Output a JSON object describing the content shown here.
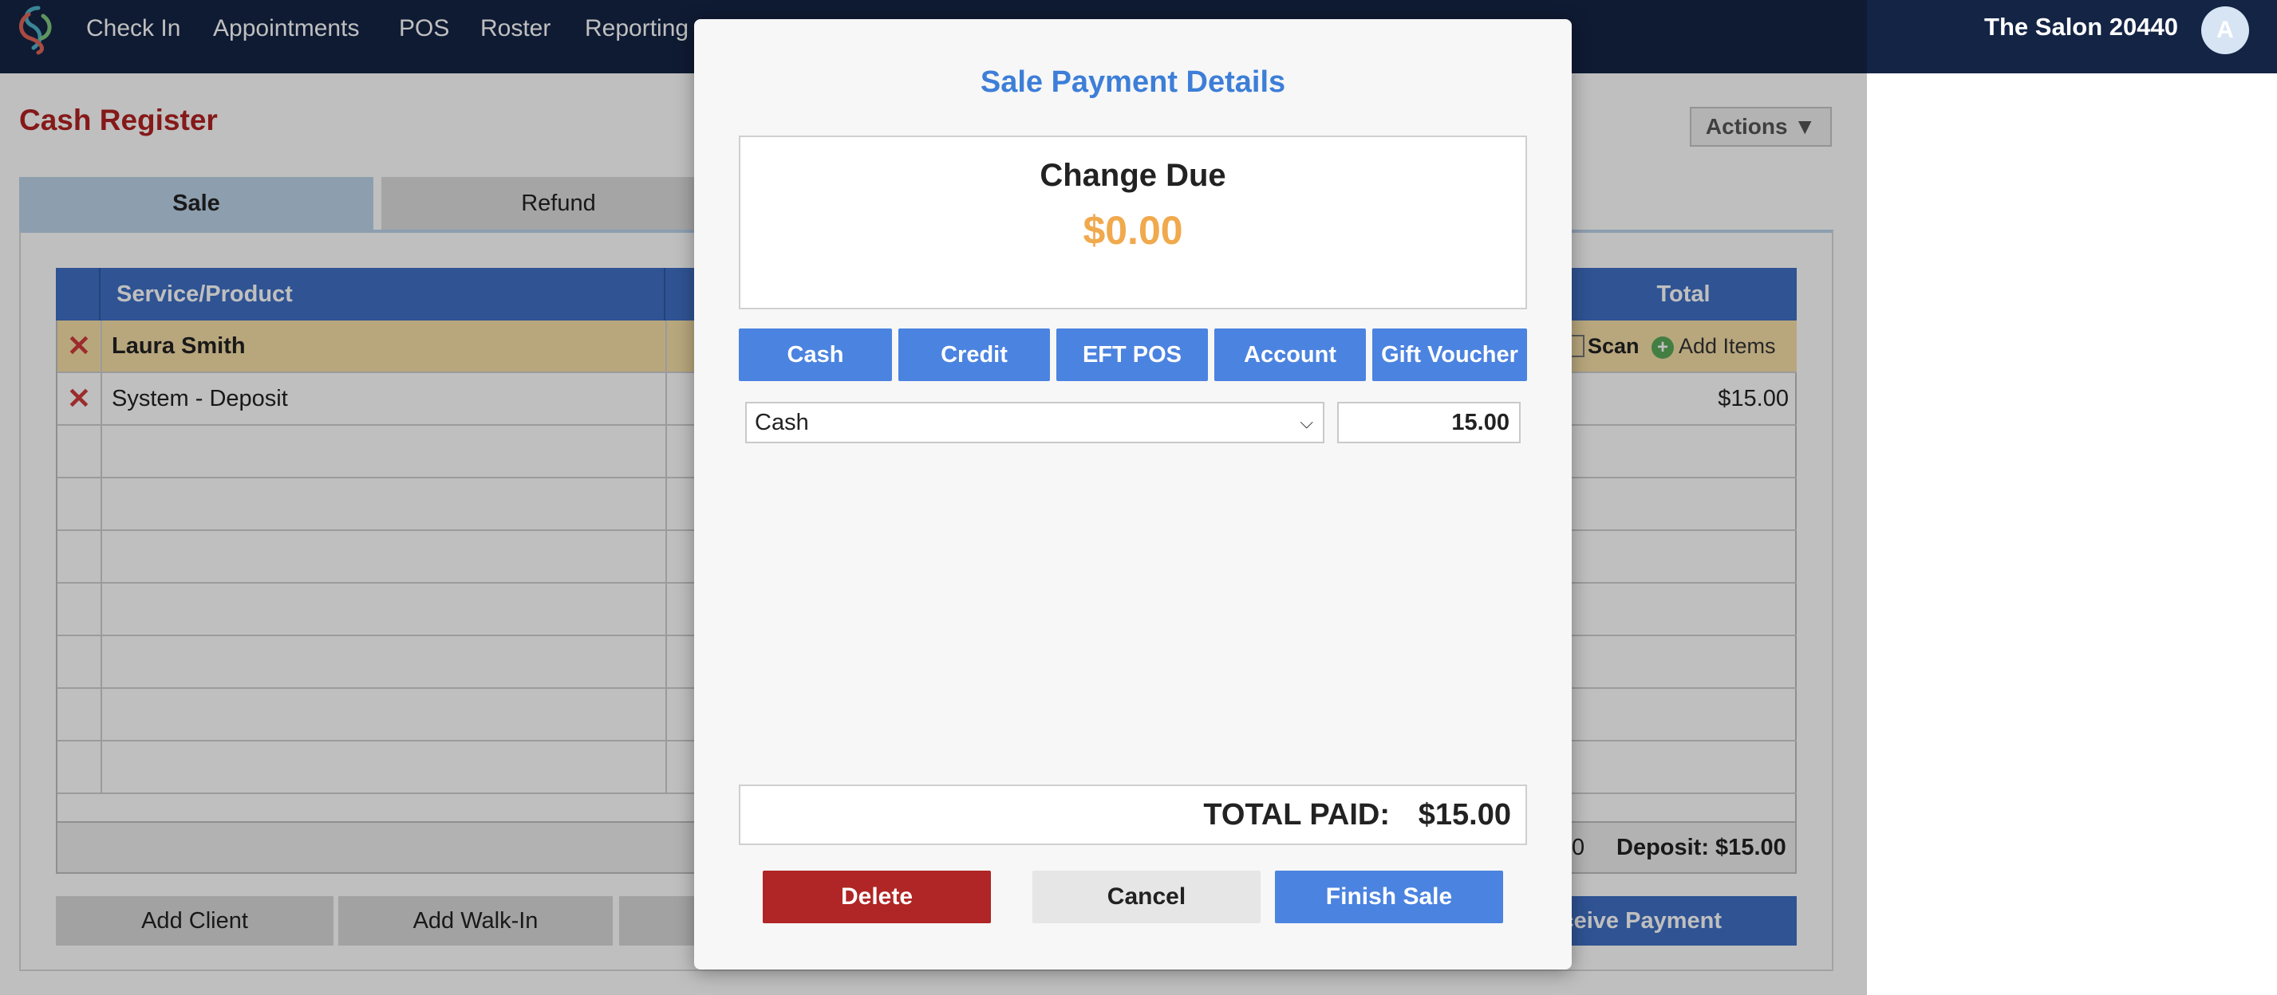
{
  "nav": {
    "items": [
      "Check In",
      "Appointments",
      "POS",
      "Roster",
      "Reporting"
    ],
    "salon_name": "The Salon 20440",
    "avatar_initial": "A"
  },
  "page": {
    "title": "Cash Register",
    "actions_label": "Actions ▼",
    "tabs": [
      "Sale",
      "Refund"
    ]
  },
  "grid": {
    "headers": {
      "service_product": "Service/Product",
      "total": "Total"
    },
    "client_row": {
      "name": "Laura Smith",
      "scan": "Scan",
      "add_items": "Add Items"
    },
    "rows": [
      {
        "name": "System - Deposit",
        "total": "$15.00"
      }
    ],
    "footer": {
      "partial_value": "0",
      "deposit": "Deposit: $15.00"
    }
  },
  "actions": {
    "add_client": "Add Client",
    "add_walkin": "Add Walk-In",
    "receive_payment": "ceive Payment"
  },
  "modal": {
    "title": "Sale Payment Details",
    "change_due_label": "Change Due",
    "change_due_amount": "$0.00",
    "payment_methods": [
      "Cash",
      "Credit",
      "EFT POS",
      "Account",
      "Gift Voucher"
    ],
    "selected_method": "Cash",
    "amount": "15.00",
    "total_paid_label": "TOTAL PAID:",
    "total_paid_value": "$15.00",
    "buttons": {
      "delete": "Delete",
      "cancel": "Cancel",
      "finish": "Finish Sale"
    }
  },
  "colors": {
    "nav_bg": "#142445",
    "accent_blue": "#4b83e0",
    "title_red": "#b22222",
    "change_orange": "#f0a94d",
    "delete_red": "#b02525",
    "client_row_bg": "#f6dfa7"
  },
  "icons": {
    "logo": "salon-logo-icon",
    "remove": "close-x-icon",
    "scan": "barcode-scan-icon",
    "add_items": "plus-circle-icon",
    "select": "chevron-down-icon"
  }
}
